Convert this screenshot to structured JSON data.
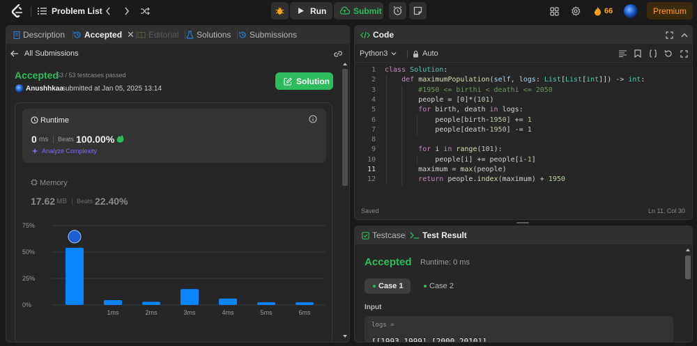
{
  "topbar": {
    "problem_list": "Problem List",
    "run": "Run",
    "submit": "Submit",
    "streak": "66",
    "premium": "Premium"
  },
  "left": {
    "tabs": [
      "Description",
      "Accepted",
      "Editorial",
      "Solutions",
      "Submissions"
    ],
    "back_label": "All Submissions",
    "status": "Accepted",
    "testcases": "53 / 53 testcases passed",
    "user": "Anushhkaa",
    "submitted": "submitted at Jan 05, 2025 13:14",
    "solution_btn": "Solution",
    "runtime": {
      "title": "Runtime",
      "value": "0",
      "unit": "ms",
      "beats_label": "Beats",
      "beats": "100.00%",
      "analyze": "Analyze Complexity"
    },
    "memory": {
      "title": "Memory",
      "value": "17.62",
      "unit": "MB",
      "beats_label": "Beats",
      "beats": "22.40%"
    }
  },
  "chart_data": {
    "type": "bar",
    "yticks": [
      "75%",
      "50%",
      "25%",
      "0%"
    ],
    "ylim": [
      0,
      75
    ],
    "xticks": [
      "1ms",
      "2ms",
      "3ms",
      "4ms",
      "5ms",
      "6ms"
    ],
    "values": [
      54,
      4.5,
      3,
      15,
      6,
      2.5,
      2.5
    ],
    "highlight_index": 0,
    "colors": {
      "bar": "#0a84ff"
    }
  },
  "code": {
    "title": "Code",
    "language": "Python3",
    "mode": "Auto",
    "status": "Saved",
    "cursor": "Ln 11, Col 30",
    "lines": [
      "1",
      "2",
      "3",
      "4",
      "5",
      "6",
      "7",
      "8",
      "9",
      "10",
      "11",
      "12"
    ]
  },
  "bottom": {
    "tabs": [
      "Testcase",
      "Test Result"
    ],
    "status": "Accepted",
    "runtime": "Runtime: 0 ms",
    "cases": [
      "Case 1",
      "Case 2"
    ],
    "input_label": "Input",
    "input_var": "logs =",
    "input_value": "[[1993,1999],[2000,2010]]"
  }
}
